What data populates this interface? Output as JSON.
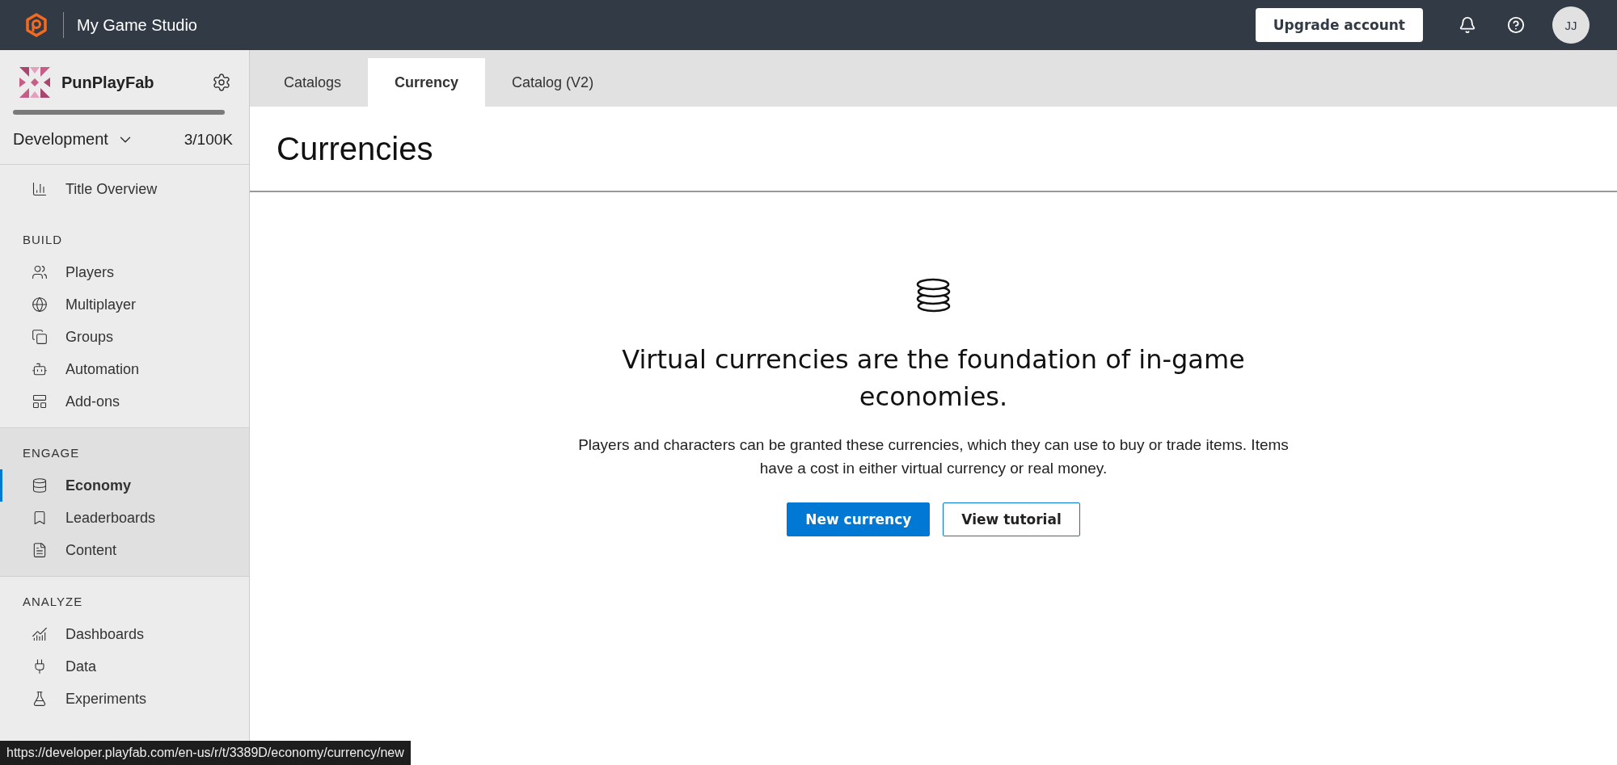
{
  "topbar": {
    "studio": "My Game Studio",
    "upgrade_button": "Upgrade account",
    "avatar": "JJ"
  },
  "sidebar": {
    "title_name": "PunPlayFab",
    "environment": "Development",
    "usage": "3/100K",
    "sections": [
      {
        "items": [
          {
            "label": "Title Overview",
            "selected": false
          }
        ]
      },
      {
        "heading": "BUILD",
        "items": [
          {
            "label": "Players",
            "selected": false
          },
          {
            "label": "Multiplayer",
            "selected": false
          },
          {
            "label": "Groups",
            "selected": false
          },
          {
            "label": "Automation",
            "selected": false
          },
          {
            "label": "Add-ons",
            "selected": false
          }
        ]
      },
      {
        "heading": "ENGAGE",
        "items": [
          {
            "label": "Economy",
            "selected": true
          },
          {
            "label": "Leaderboards",
            "selected": false
          },
          {
            "label": "Content",
            "selected": false
          }
        ]
      },
      {
        "heading": "ANALYZE",
        "items": [
          {
            "label": "Dashboards",
            "selected": false
          },
          {
            "label": "Data",
            "selected": false
          },
          {
            "label": "Experiments",
            "selected": false
          }
        ]
      }
    ]
  },
  "tabs": [
    {
      "label": "Catalogs",
      "selected": false
    },
    {
      "label": "Currency",
      "selected": true
    },
    {
      "label": "Catalog (V2)",
      "selected": false
    }
  ],
  "page_title": "Currencies",
  "empty_state": {
    "headline": "Virtual currencies are the foundation of in-game economies.",
    "description": "Players and characters can be granted these currencies, which they can use to buy or trade items. Items have a cost in either virtual currency or real money.",
    "primary_button": "New currency",
    "secondary_button": "View tutorial"
  },
  "status_url": "https://developer.playfab.com/en-us/r/t/3389D/economy/currency/new"
}
